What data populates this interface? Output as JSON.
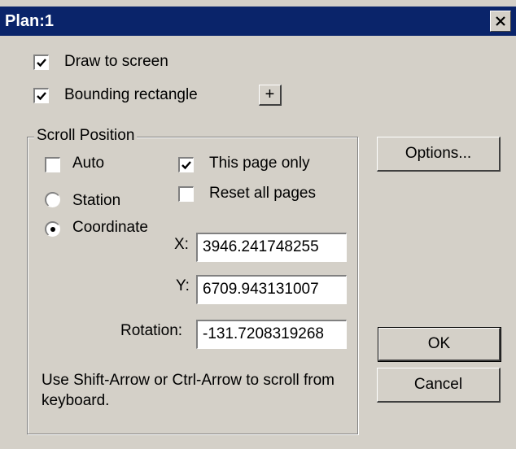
{
  "window": {
    "title": "Plan:1",
    "close_icon": "close-icon"
  },
  "options": {
    "draw_to_screen": {
      "label": "Draw to screen",
      "checked": true
    },
    "bounding_rectangle": {
      "label": "Bounding rectangle",
      "checked": true
    },
    "plus_button_label": "+"
  },
  "scroll_position": {
    "title": "Scroll Position",
    "auto": {
      "label": "Auto",
      "checked": false
    },
    "this_page_only": {
      "label": "This page only",
      "checked": true
    },
    "reset_all_pages": {
      "label": "Reset all pages",
      "checked": false
    },
    "station": {
      "label": "Station",
      "selected": false
    },
    "coordinate": {
      "label": "Coordinate",
      "selected": true
    },
    "x": {
      "label": "X:",
      "value": "3946.241748255"
    },
    "y": {
      "label": "Y:",
      "value": "6709.943131007"
    },
    "rotation": {
      "label": "Rotation:",
      "value": "-131.7208319268"
    },
    "help_text": "Use Shift-Arrow or Ctrl-Arrow to scroll from keyboard."
  },
  "buttons": {
    "options": "Options...",
    "ok": "OK",
    "cancel": "Cancel"
  },
  "colors": {
    "titlebar": "#0a246a",
    "face": "#d4d0c8",
    "field": "#ffffff"
  }
}
